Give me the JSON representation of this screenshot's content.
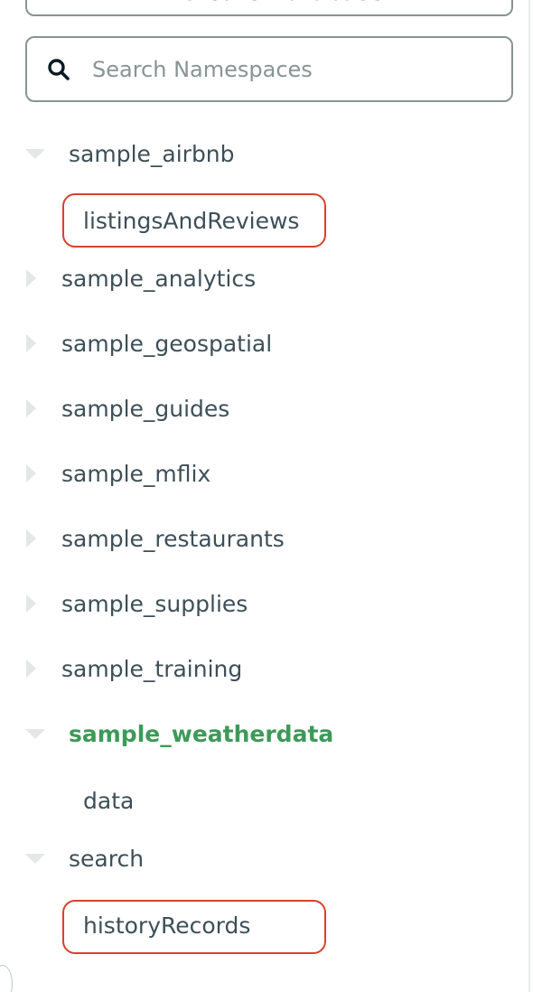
{
  "create_database": {
    "label": "+ Create Database"
  },
  "search": {
    "placeholder": "Search Namespaces",
    "value": ""
  },
  "tree": {
    "sample_airbnb": {
      "label": "sample_airbnb",
      "expanded": true,
      "collections": [
        "listingsAndReviews"
      ]
    },
    "sample_analytics": {
      "label": "sample_analytics",
      "expanded": false
    },
    "sample_geospatial": {
      "label": "sample_geospatial",
      "expanded": false
    },
    "sample_guides": {
      "label": "sample_guides",
      "expanded": false
    },
    "sample_mflix": {
      "label": "sample_mflix",
      "expanded": false
    },
    "sample_restaurants": {
      "label": "sample_restaurants",
      "expanded": false
    },
    "sample_supplies": {
      "label": "sample_supplies",
      "expanded": false
    },
    "sample_training": {
      "label": "sample_training",
      "expanded": false
    },
    "sample_weatherdata": {
      "label": "sample_weatherdata",
      "expanded": true,
      "active": true,
      "collections": [
        "data"
      ]
    },
    "search": {
      "label": "search",
      "expanded": true,
      "collections": [
        "historyRecords"
      ]
    }
  },
  "highlighted_items": [
    "listingsAndReviews",
    "historyRecords"
  ],
  "colors": {
    "active_database": "#3d9a58",
    "highlight_border": "#d9412c",
    "caret": "#e3e7e8",
    "text": "#3d4f58"
  }
}
